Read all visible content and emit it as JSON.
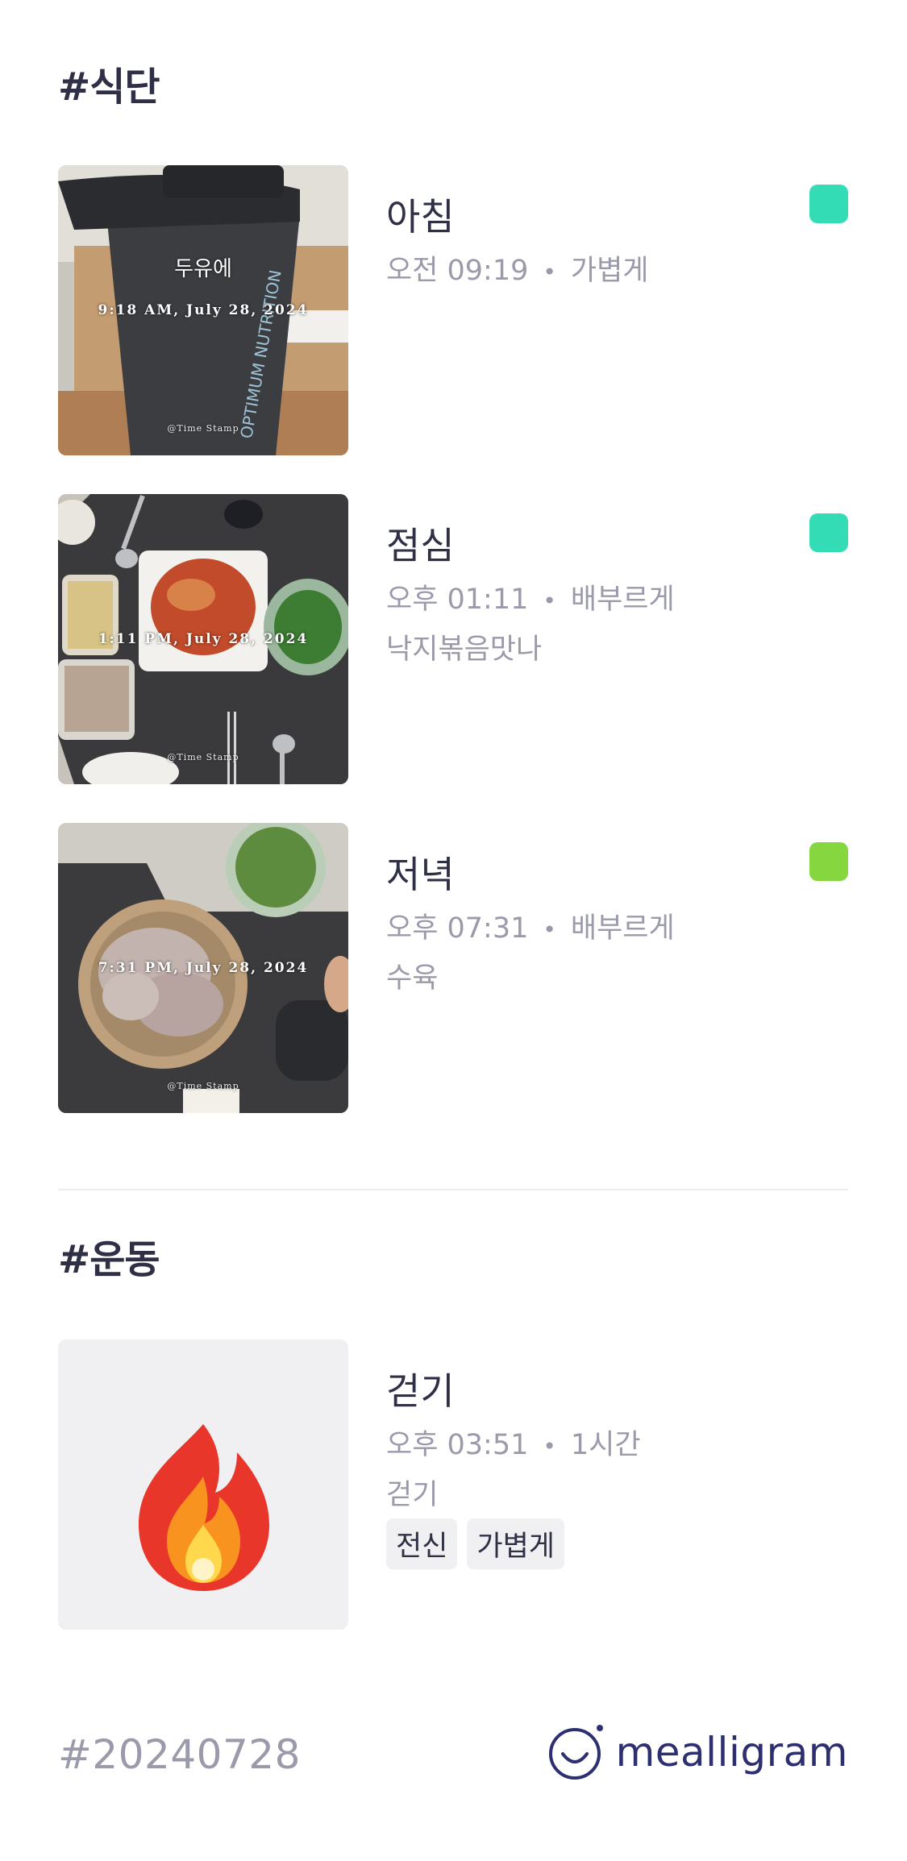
{
  "sections": {
    "meal_title": "#식단",
    "exercise_title": "#운동"
  },
  "meals": [
    {
      "name": "아침",
      "time": "오전 09:19",
      "fullness": "가볍게",
      "description": "",
      "status_color": "#34dcb6",
      "photo": {
        "note": "두유에",
        "timestamp": "9:18 AM, July 28, 2024",
        "logo": "@Time Stamp"
      }
    },
    {
      "name": "점심",
      "time": "오후 01:11",
      "fullness": "배부르게",
      "description": "낙지볶음맛나",
      "status_color": "#34dcb6",
      "photo": {
        "note": "",
        "timestamp": "1:11 PM, July 28, 2024",
        "logo": "@Time Stamp"
      }
    },
    {
      "name": "저녁",
      "time": "오후 07:31",
      "fullness": "배부르게",
      "description": "수육",
      "status_color": "#86d63f",
      "photo": {
        "note": "",
        "timestamp": "7:31 PM, July 28, 2024",
        "logo": "@Time Stamp"
      }
    }
  ],
  "exercise": {
    "name": "걷기",
    "time": "오후 03:51",
    "duration": "1시간",
    "description": "걷기",
    "tags": [
      "전신",
      "가볍게"
    ],
    "icon": "fire-icon"
  },
  "footer": {
    "date_tag": "#20240728",
    "brand": "mealligram",
    "brand_icon": "smile-logo-icon"
  }
}
